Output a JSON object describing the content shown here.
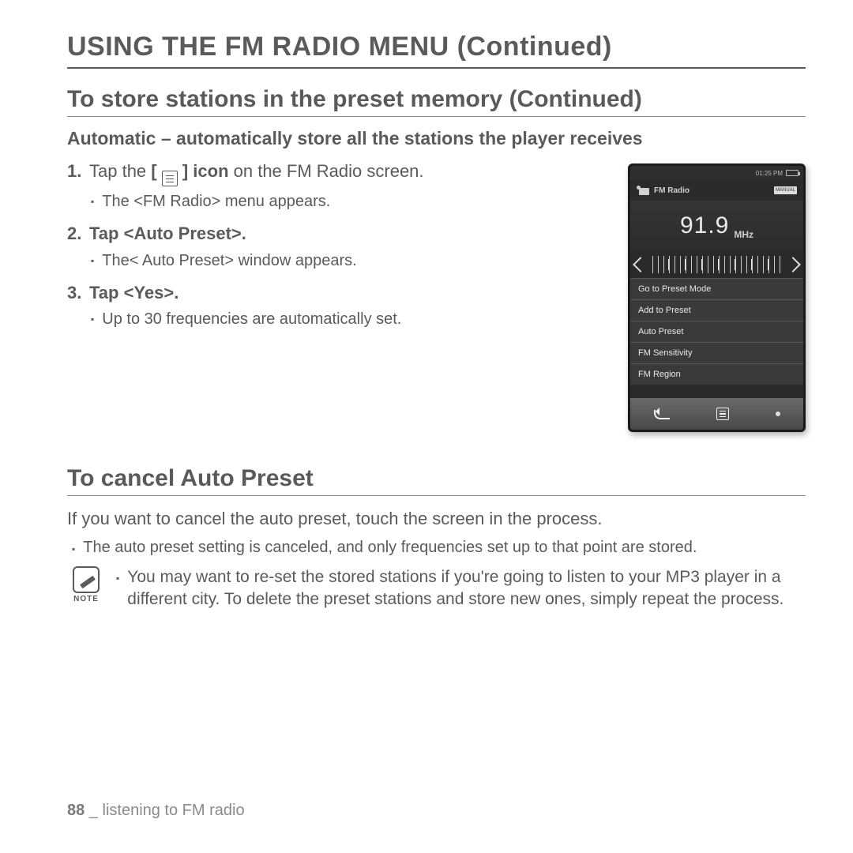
{
  "heading1": "USING THE FM RADIO MENU (Continued)",
  "heading2a": "To store stations in the preset memory (Continued)",
  "heading3": "Automatic – automatically store all the stations the player receives",
  "step1_pre": "Tap the ",
  "step1_mid": "[ ",
  "step1_mid_close": " ] icon",
  "step1_post": " on the FM Radio screen.",
  "step1_sub": "The <FM Radio> menu appears.",
  "step2_main": "Tap <Auto Preset>.",
  "step2_sub": "The< Auto Preset> window appears.",
  "step3_main": "Tap <Yes>.",
  "step3_sub": "Up to 30 frequencies are automatically set.",
  "heading2b": "To cancel Auto Preset",
  "cancel_para": "If you want to cancel the auto preset, touch the screen in the process.",
  "cancel_bullet": "The auto preset setting is canceled, and only frequencies set up to that point are stored.",
  "note_label": "NOTE",
  "note_text": "You may want to re-set the stored stations if you're going to listen to your MP3 player in a different city. To delete the preset stations and store new ones, simply repeat the process.",
  "footer_page": "88",
  "footer_sep": " _ ",
  "footer_section": "listening to FM radio",
  "device": {
    "status_time": "01:25 PM",
    "title": "FM Radio",
    "mode_badge": "MANUAL",
    "frequency": "91.9",
    "unit": "MHz",
    "menu_items": [
      "Go to Preset Mode",
      "Add to Preset",
      "Auto Preset",
      "FM Sensitivity",
      "FM Region"
    ]
  }
}
